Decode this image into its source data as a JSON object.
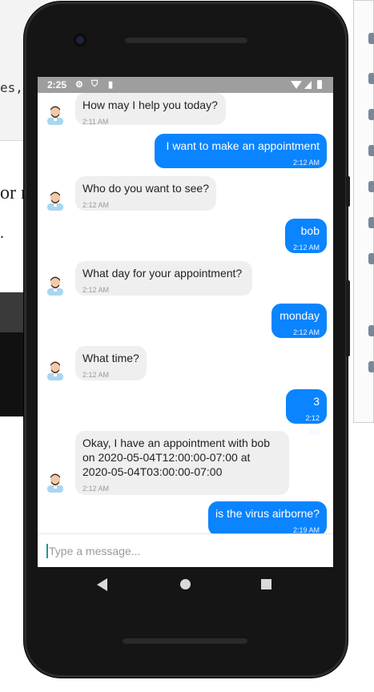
{
  "background": {
    "code_fragment": "es,",
    "text_fragment": "or r",
    "text_fragment2": "."
  },
  "status_bar": {
    "time": "2:25",
    "icons": [
      "settings-icon",
      "shield-icon",
      "sim-card-icon",
      "wifi-icon",
      "signal-icon",
      "battery-icon"
    ]
  },
  "chat": {
    "messages": [
      {
        "sender": "bot",
        "text": "How may I help you today?",
        "time": "2:11 AM"
      },
      {
        "sender": "user",
        "text": "I want to make an appointment",
        "time": "2:12 AM"
      },
      {
        "sender": "bot",
        "text": "Who do you want to see?",
        "time": "2:12 AM"
      },
      {
        "sender": "user",
        "text": "bob",
        "time": "2:12 AM"
      },
      {
        "sender": "bot",
        "text": "What day for your appointment?",
        "time": "2:12 AM"
      },
      {
        "sender": "user",
        "text": "monday",
        "time": "2:12 AM"
      },
      {
        "sender": "bot",
        "text": "What time?",
        "time": "2:12 AM"
      },
      {
        "sender": "user",
        "text": "3",
        "time": "2:12 AM"
      },
      {
        "sender": "bot",
        "text": "Okay, I have an appointment with bob\non 2020-05-04T12:00:00-07:00 at\n2020-05-04T03:00:00-07:00",
        "time": "2:12 AM"
      },
      {
        "sender": "user",
        "text": "is the virus airborne?",
        "time": "2:19 AM"
      }
    ]
  },
  "composer": {
    "placeholder": "Type a message..."
  },
  "nav": {
    "icons": [
      "back-icon",
      "home-icon",
      "recent-apps-icon"
    ]
  },
  "colors": {
    "user_bubble": "#0a84ff",
    "bot_bubble": "#efefef",
    "status_bar": "#9e9e9e",
    "phone_frame": "#151515"
  }
}
